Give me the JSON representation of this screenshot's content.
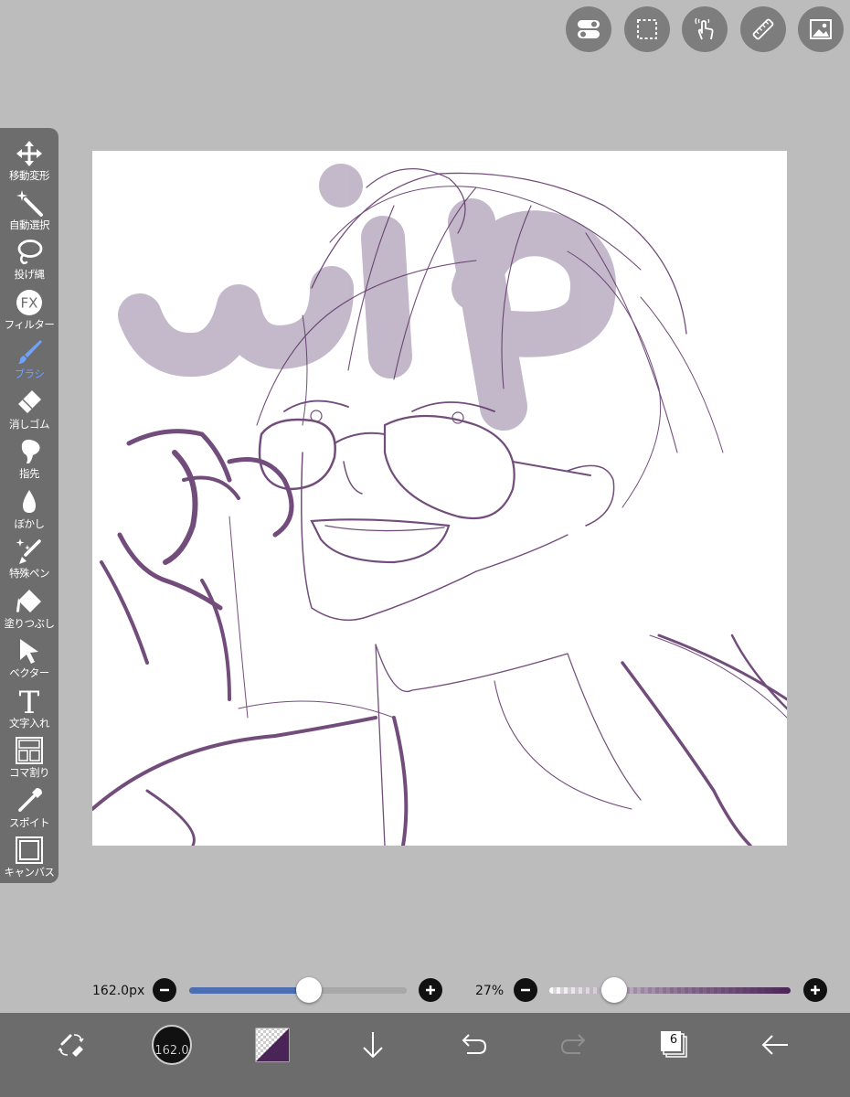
{
  "top_toolbar": {
    "buttons": [
      {
        "icon": "toggle-icon"
      },
      {
        "icon": "selection-icon"
      },
      {
        "icon": "touch-gesture-icon"
      },
      {
        "icon": "ruler-icon"
      },
      {
        "icon": "image-icon"
      }
    ]
  },
  "tools": [
    {
      "id": "move",
      "label": "移動変形",
      "icon": "move-arrows-icon"
    },
    {
      "id": "auto-select",
      "label": "自動選択",
      "icon": "magic-wand-icon"
    },
    {
      "id": "lasso",
      "label": "投げ縄",
      "icon": "lasso-icon"
    },
    {
      "id": "filter",
      "label": "フィルター",
      "icon": "fx-icon",
      "icon_text": "FX"
    },
    {
      "id": "brush",
      "label": "ブラシ",
      "icon": "brush-icon",
      "active": true
    },
    {
      "id": "eraser",
      "label": "消しゴム",
      "icon": "eraser-icon"
    },
    {
      "id": "finger",
      "label": "指先",
      "icon": "finger-icon"
    },
    {
      "id": "blur",
      "label": "ぼかし",
      "icon": "droplet-icon"
    },
    {
      "id": "special-pen",
      "label": "特殊ペン",
      "icon": "sparkle-pen-icon"
    },
    {
      "id": "fill",
      "label": "塗りつぶし",
      "icon": "bucket-icon"
    },
    {
      "id": "vector",
      "label": "ベクター",
      "icon": "cursor-arrow-icon"
    },
    {
      "id": "text",
      "label": "文字入れ",
      "icon": "text-icon",
      "icon_text": "T"
    },
    {
      "id": "frame",
      "label": "コマ割り",
      "icon": "panel-divider-icon"
    },
    {
      "id": "eyedropper",
      "label": "スポイト",
      "icon": "eyedropper-icon"
    },
    {
      "id": "canvas",
      "label": "キャンバス",
      "icon": "canvas-icon"
    }
  ],
  "canvas": {
    "artwork": "pencil sketch of a smiling person with glasses adjusting them with one hand",
    "watermark_text": "WIP",
    "stroke_color": "#5a2f64",
    "watermark_color": "#9c8aa6"
  },
  "brush_size": {
    "value_label": "162.0px",
    "fraction": 0.55
  },
  "opacity": {
    "value_label": "27%",
    "fraction": 0.27
  },
  "bottom_bar": {
    "brush_preview_label": "162.0",
    "current_color": "#4a2456",
    "layer_count": "6",
    "icons": [
      "swap-pen-eraser-icon",
      "brush-preview-icon",
      "color-swatch-icon",
      "download-icon",
      "undo-icon",
      "redo-icon",
      "layers-icon",
      "back-arrow-icon"
    ]
  },
  "colors": {
    "accent_blue": "#4b6fb2",
    "active_tool": "#6ea2ff",
    "panel_bg": "#6d6d6d",
    "workspace_bg": "#bcbcbc"
  }
}
